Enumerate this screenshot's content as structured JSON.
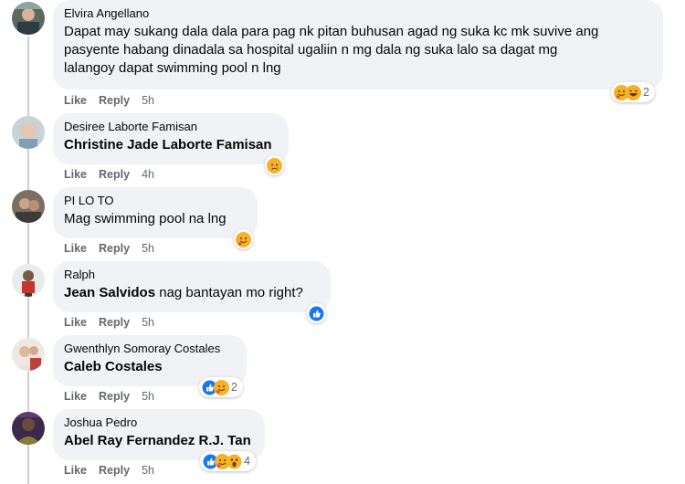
{
  "comments": [
    {
      "name": "Elvira Angellano",
      "text_lines": [
        "Dapat may sukang dala dala para pag nk pitan buhusan agad ng suka kc mk suvive ang",
        "pasyente habang dinadala sa hospital ugaliin n mg dala ng suka lalo sa dagat mg",
        "lalangoy dapat swimming pool n lng"
      ],
      "tag": "",
      "time": "5h",
      "reactions": [
        "care-icon",
        "haha-icon"
      ],
      "reaction_count": "2"
    },
    {
      "name": "Desiree Laborte Famisan",
      "tag": "Christine Jade Laborte Famisan",
      "text": "",
      "time": "4h",
      "reactions": [
        "sad-icon"
      ],
      "reaction_count": ""
    },
    {
      "name": "PI LO TO",
      "tag": "",
      "text": "Mag swimming pool na lng",
      "time": "5h",
      "reactions": [
        "care-icon"
      ],
      "reaction_count": ""
    },
    {
      "name": "Ralph",
      "tag": "Jean Salvidos",
      "text": " nag bantayan mo right?",
      "time": "5h",
      "reactions": [
        "like-icon"
      ],
      "reaction_count": ""
    },
    {
      "name": "Gwenthlyn Somoray Costales",
      "tag": "Caleb Costales",
      "text": "",
      "time": "5h",
      "reactions": [
        "like-icon",
        "care-icon"
      ],
      "reaction_count": "2"
    },
    {
      "name": "Joshua Pedro",
      "tag": "Abel Ray Fernandez R.J. Tan",
      "text": "",
      "time": "5h",
      "reactions": [
        "like-icon",
        "care-icon",
        "wow-icon"
      ],
      "reaction_count": "4"
    }
  ],
  "labels": {
    "like": "Like",
    "reply": "Reply"
  },
  "colors": {
    "bubble": "#f0f2f5",
    "meta": "#65676b",
    "like_blue": "#1877f2",
    "emoji_yellow": "#f7b125"
  }
}
